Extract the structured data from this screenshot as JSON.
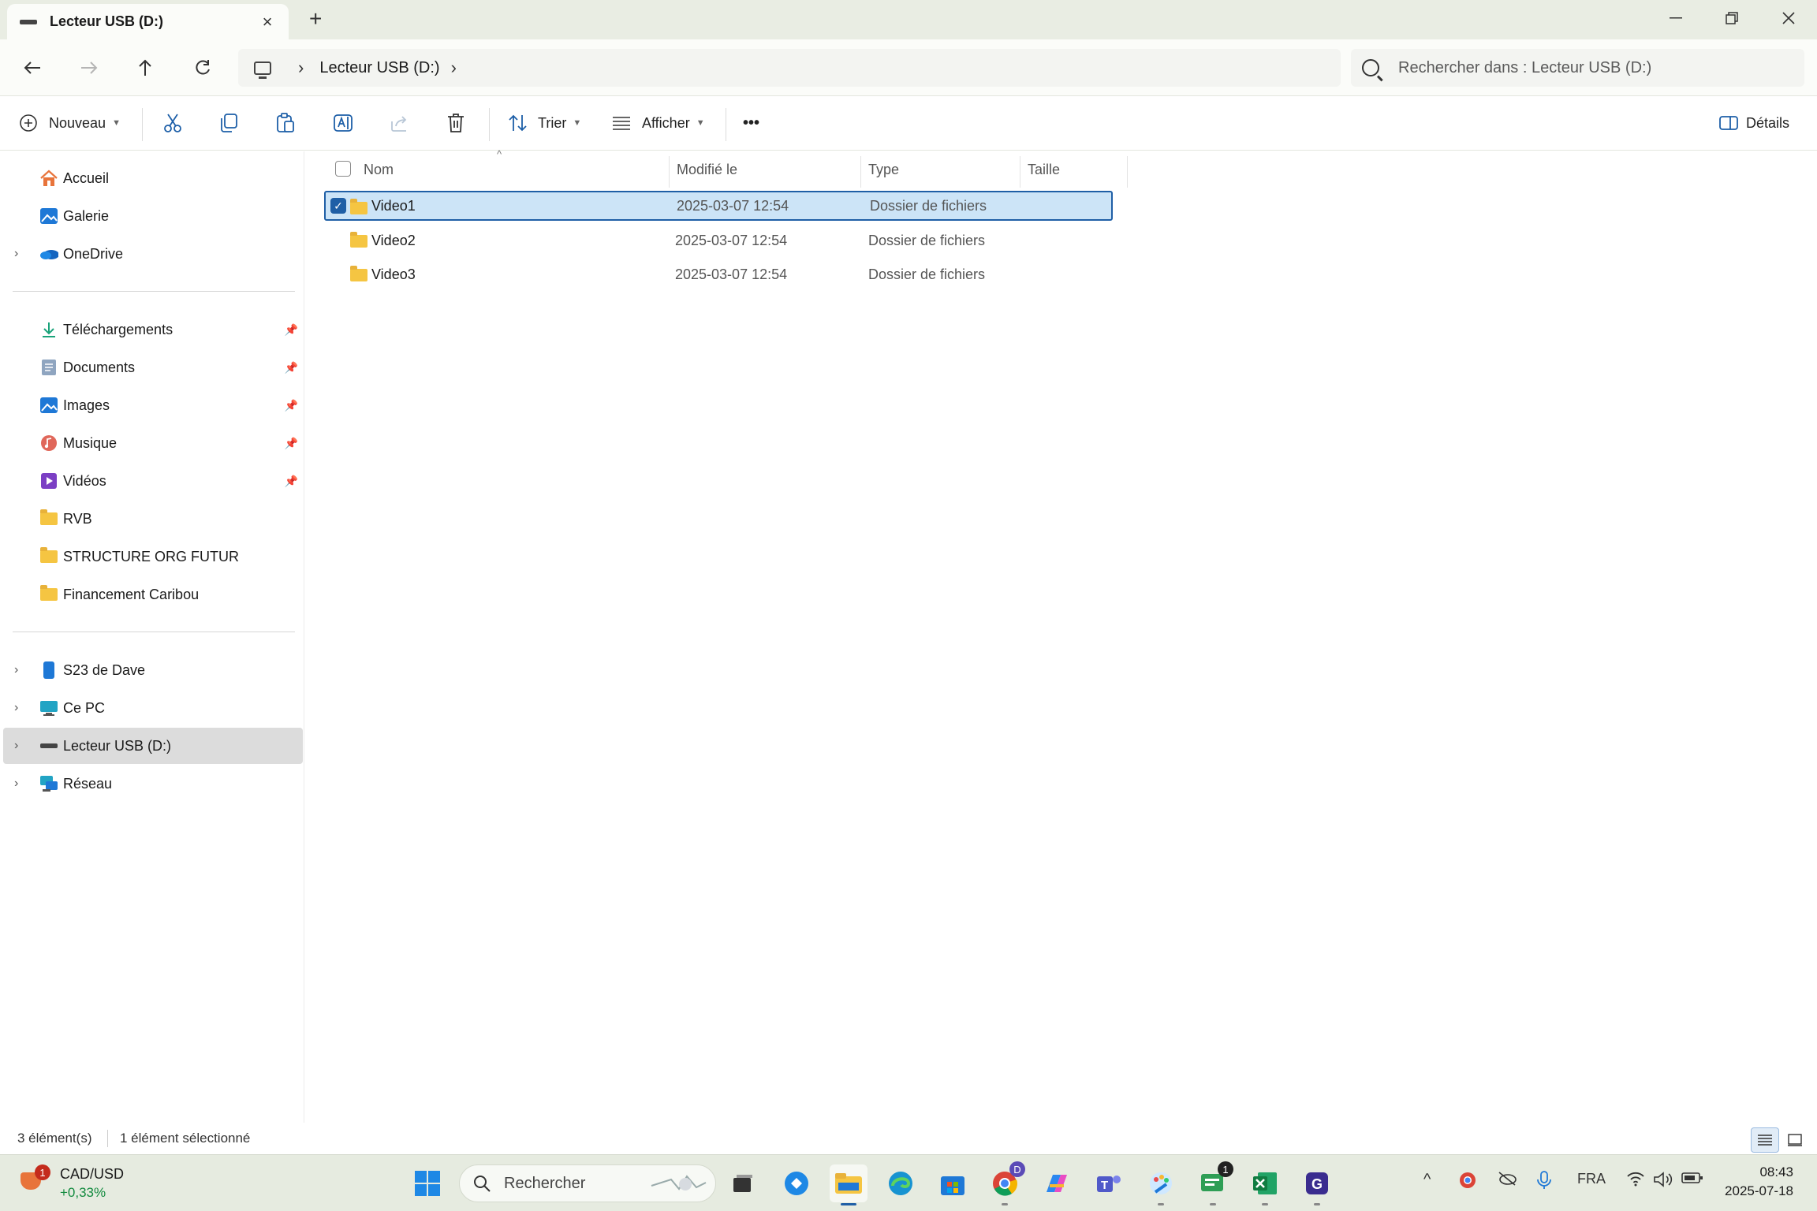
{
  "window": {
    "tab_title": "Lecteur USB (D:)",
    "new_tab": "+",
    "controls": {
      "minimize": "—",
      "restore": "❐",
      "close": "✕"
    }
  },
  "addressbar": {
    "crumbs": [
      "Lecteur USB (D:)"
    ],
    "search_placeholder": "Rechercher dans : Lecteur USB (D:)"
  },
  "toolbar": {
    "new_label": "Nouveau",
    "sort_label": "Trier",
    "view_label": "Afficher",
    "more_label": "•••",
    "details_label": "Détails"
  },
  "sidebar": {
    "top": [
      {
        "label": "Accueil",
        "icon": "home-icon"
      },
      {
        "label": "Galerie",
        "icon": "gallery-icon"
      },
      {
        "label": "OneDrive",
        "icon": "onedrive-icon",
        "expandable": true
      }
    ],
    "pinned": [
      {
        "label": "Téléchargements",
        "icon": "download-icon",
        "pinned": true
      },
      {
        "label": "Documents",
        "icon": "documents-icon",
        "pinned": true
      },
      {
        "label": "Images",
        "icon": "images-icon",
        "pinned": true
      },
      {
        "label": "Musique",
        "icon": "music-icon",
        "pinned": true
      },
      {
        "label": "Vidéos",
        "icon": "videos-icon",
        "pinned": true
      },
      {
        "label": "RVB",
        "icon": "folder-icon"
      },
      {
        "label": "STRUCTURE ORG FUTUR",
        "icon": "folder-icon"
      },
      {
        "label": "Financement Caribou",
        "icon": "folder-icon"
      }
    ],
    "devices": [
      {
        "label": "S23 de Dave",
        "icon": "phone-icon"
      },
      {
        "label": "Ce PC",
        "icon": "pc-icon"
      },
      {
        "label": "Lecteur USB (D:)",
        "icon": "usb-drive-icon",
        "selected": true
      },
      {
        "label": "Réseau",
        "icon": "network-icon"
      }
    ]
  },
  "columns": {
    "name": "Nom",
    "modified": "Modifié le",
    "type": "Type",
    "size": "Taille"
  },
  "files": [
    {
      "name": "Video1",
      "modified": "2025-03-07 12:54",
      "type": "Dossier de fichiers",
      "selected": true
    },
    {
      "name": "Video2",
      "modified": "2025-03-07 12:54",
      "type": "Dossier de fichiers"
    },
    {
      "name": "Video3",
      "modified": "2025-03-07 12:54",
      "type": "Dossier de fichiers"
    }
  ],
  "status": {
    "count": "3 élément(s)",
    "selection": "1 élément sélectionné"
  },
  "taskbar": {
    "widget_badge": "1",
    "widget_title": "CAD/USD",
    "widget_value": "+0,33%",
    "search_placeholder": "Rechercher",
    "chrome_badge": "D",
    "chat_badge": "1",
    "language": "FRA",
    "time": "08:43",
    "date": "2025-07-18"
  },
  "colors": {
    "accent": "#1f5fa6",
    "selection_bg": "#cce4f7",
    "folder": "#f5c542",
    "taskbar_bg": "#e6ebe0"
  }
}
